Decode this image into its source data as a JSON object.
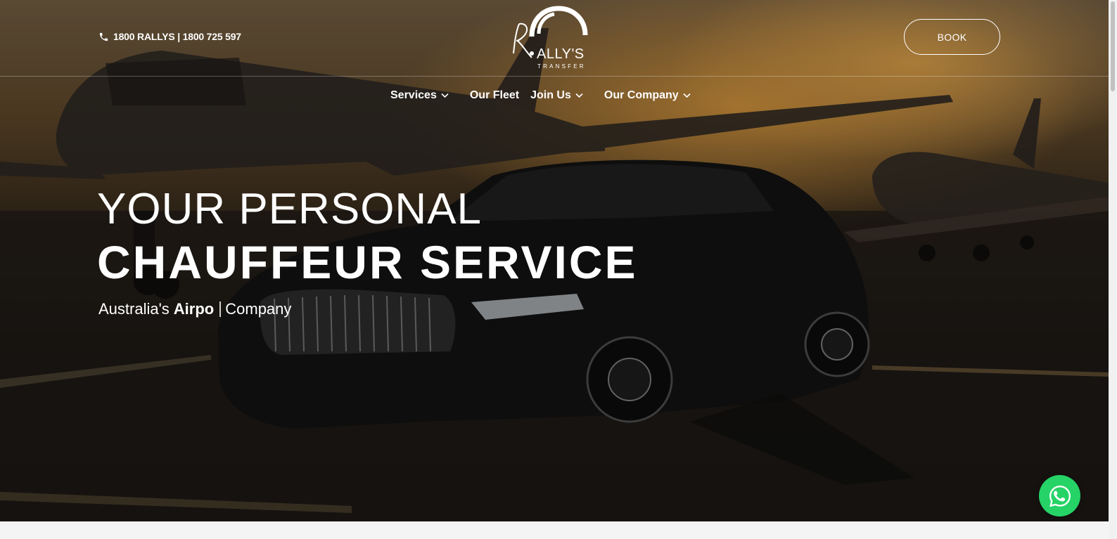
{
  "header": {
    "phone_text": "1800 RALLYS | 1800 725 597",
    "logo_text": "ALLY'S",
    "logo_sub": "TRANSFER",
    "book_label": "BOOK"
  },
  "nav": {
    "items": [
      {
        "label": "Services",
        "has_dropdown": true
      },
      {
        "label": "Our Fleet",
        "has_dropdown": false
      },
      {
        "label": "Join Us",
        "has_dropdown": true
      },
      {
        "label": "Our Company",
        "has_dropdown": true
      }
    ]
  },
  "hero": {
    "headline_line1": "YOUR PERSONAL",
    "headline_line2": "CHAUFFEUR SERVICE",
    "tagline_prefix": "Australia's",
    "tagline_strong": "Airpo",
    "tagline_suffix": "Company"
  },
  "icons": {
    "phone": "phone-icon",
    "chevron": "chevron-down-icon",
    "whatsapp": "whatsapp-icon"
  },
  "colors": {
    "whatsapp_green": "#25d366",
    "text": "#ffffff"
  }
}
